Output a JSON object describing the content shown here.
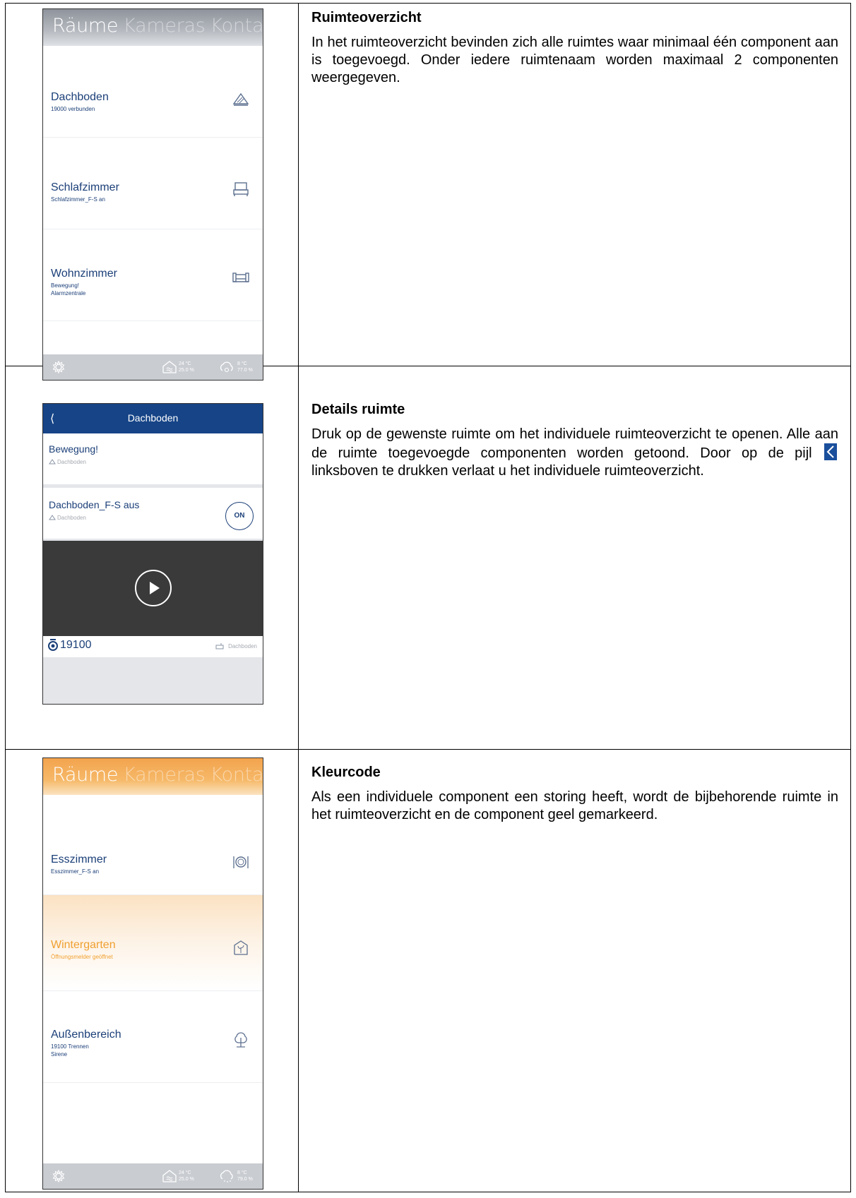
{
  "sections": [
    {
      "title": "Ruimteoverzicht",
      "body": "In het ruimteoverzicht bevinden zich alle ruimtes waar minimaal één component aan is toegevoegd. Onder iedere ruimtenaam worden maximaal 2 componenten weergegeven."
    },
    {
      "title": "Details ruimte",
      "body_before": "Druk op de gewenste ruimte om het individuele ruimteoverzicht te openen. Alle aan de ruimte toegevoegde componenten worden getoond. Door op de pijl",
      "body_after": "linksboven te drukken verlaat u het individuele ruimteoverzicht."
    },
    {
      "title": "Kleurcode",
      "body": "Als een individuele component een storing heeft, wordt de bijbehorende ruimte in het ruimteoverzicht en de component geel gemarkeerd."
    }
  ],
  "screen1": {
    "tabs": [
      "Räume",
      "Kameras",
      "Kontak"
    ],
    "rooms": [
      {
        "name": "Dachboden",
        "sub": [
          "19000 verbunden"
        ],
        "icon": "attic-icon"
      },
      {
        "name": "Schlafzimmer",
        "sub": [
          "Schlafzimmer_F-S an"
        ],
        "icon": "bed-icon"
      },
      {
        "name": "Wohnzimmer",
        "sub": [
          "Bewegung!",
          "Alarmzentrale"
        ],
        "icon": "sofa-icon"
      }
    ],
    "footer": {
      "indoor_temp": "24 °C",
      "indoor_hum": "25.0 %",
      "outdoor_temp": "8 °C",
      "outdoor_hum": "77.0 %"
    }
  },
  "screen2": {
    "title": "Dachboden",
    "items": [
      {
        "name": "Bewegung!",
        "location": "Dachboden"
      },
      {
        "name": "Dachboden_F-S aus",
        "location": "Dachboden",
        "button": "ON"
      }
    ],
    "camera": {
      "name": "19100",
      "location": "Dachboden"
    }
  },
  "screen3": {
    "tabs": [
      "Räume",
      "Kameras",
      "Kontak"
    ],
    "rooms": [
      {
        "name": "Esszimmer",
        "sub": [
          "Esszimmer_F-S an"
        ],
        "icon": "dining-icon"
      },
      {
        "name": "Wintergarten",
        "sub": [
          "Öffnungsmelder geöffnet"
        ],
        "icon": "plant-house-icon",
        "warning": true
      },
      {
        "name": "Außenbereich",
        "sub": [
          "19100 Trennen",
          "Sirene"
        ],
        "icon": "tree-icon"
      }
    ],
    "footer": {
      "indoor_temp": "24 °C",
      "indoor_hum": "25.0 %",
      "outdoor_temp": "8 °C",
      "outdoor_hum": "79.0 %"
    }
  },
  "colors": {
    "brand_blue": "#164487",
    "text_blue": "#1b3f78",
    "warning_orange": "#f0a030",
    "footer_gray": "#c9ccd1"
  }
}
